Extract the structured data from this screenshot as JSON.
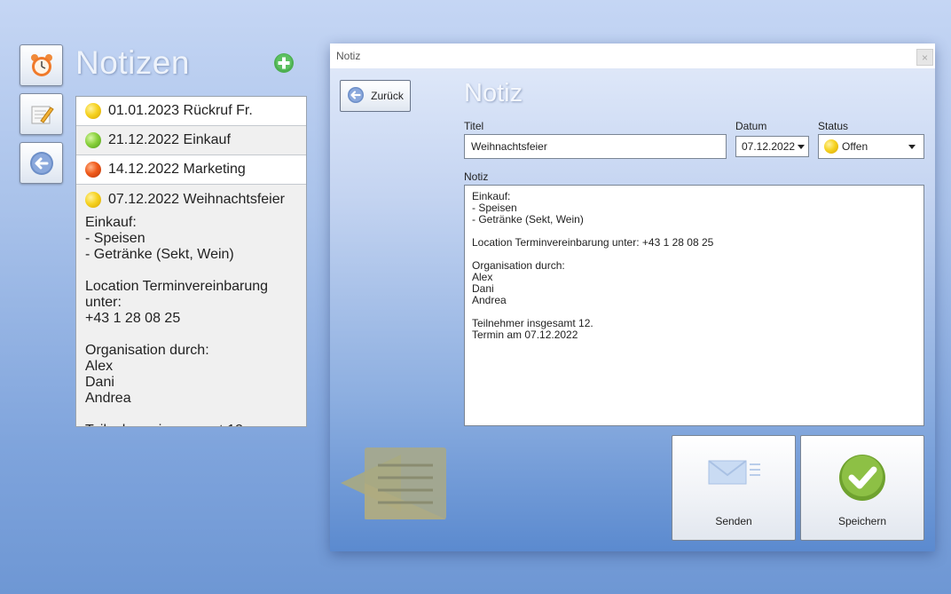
{
  "app": {
    "title": "Notizen"
  },
  "sidebar": {
    "buttons": [
      {
        "name": "alarm-clock-icon"
      },
      {
        "name": "notepad-pencil-icon"
      },
      {
        "name": "arrow-left-icon"
      }
    ]
  },
  "notes": {
    "items": [
      {
        "label": "01.01.2023 Rückruf Fr.",
        "status": "yellow"
      },
      {
        "label": "21.12.2022 Einkauf",
        "status": "green"
      },
      {
        "label": "14.12.2022 Marketing",
        "status": "red"
      },
      {
        "label": "07.12.2022 Weihnachtsfeier",
        "status": "yellow",
        "body": "Einkauf:\n- Speisen\n- Getränke (Sekt, Wein)\n\nLocation Terminvereinbarung unter:\n+43 1 28 08 25\n\nOrganisation durch:\nAlex\nDani\nAndrea\n\nTeilnehmer insgesamt 12."
      }
    ]
  },
  "dialog": {
    "window_title": "Notiz",
    "close_glyph": "×",
    "back_label": "Zurück",
    "heading": "Notiz",
    "titel_label": "Titel",
    "titel_value": "Weihnachtsfeier",
    "datum_label": "Datum",
    "datum_value": "07.12.2022",
    "status_label": "Status",
    "status_value": "Offen",
    "notiz_label": "Notiz",
    "notiz_text": "Einkauf:\n- Speisen\n- Getränke (Sekt, Wein)\n\nLocation Terminvereinbarung unter: +43 1 28 08 25\n\nOrganisation durch:\nAlex\nDani\nAndrea\n\nTeilnehmer insgesamt 12.\nTermin am 07.12.2022",
    "send_label": "Senden",
    "save_label": "Speichern"
  },
  "colors": {
    "status_yellow": "#f6d322",
    "status_green": "#8ad13d",
    "status_red": "#f05a1a",
    "add_green": "#4caf50",
    "save_green": "#7fb43a"
  }
}
